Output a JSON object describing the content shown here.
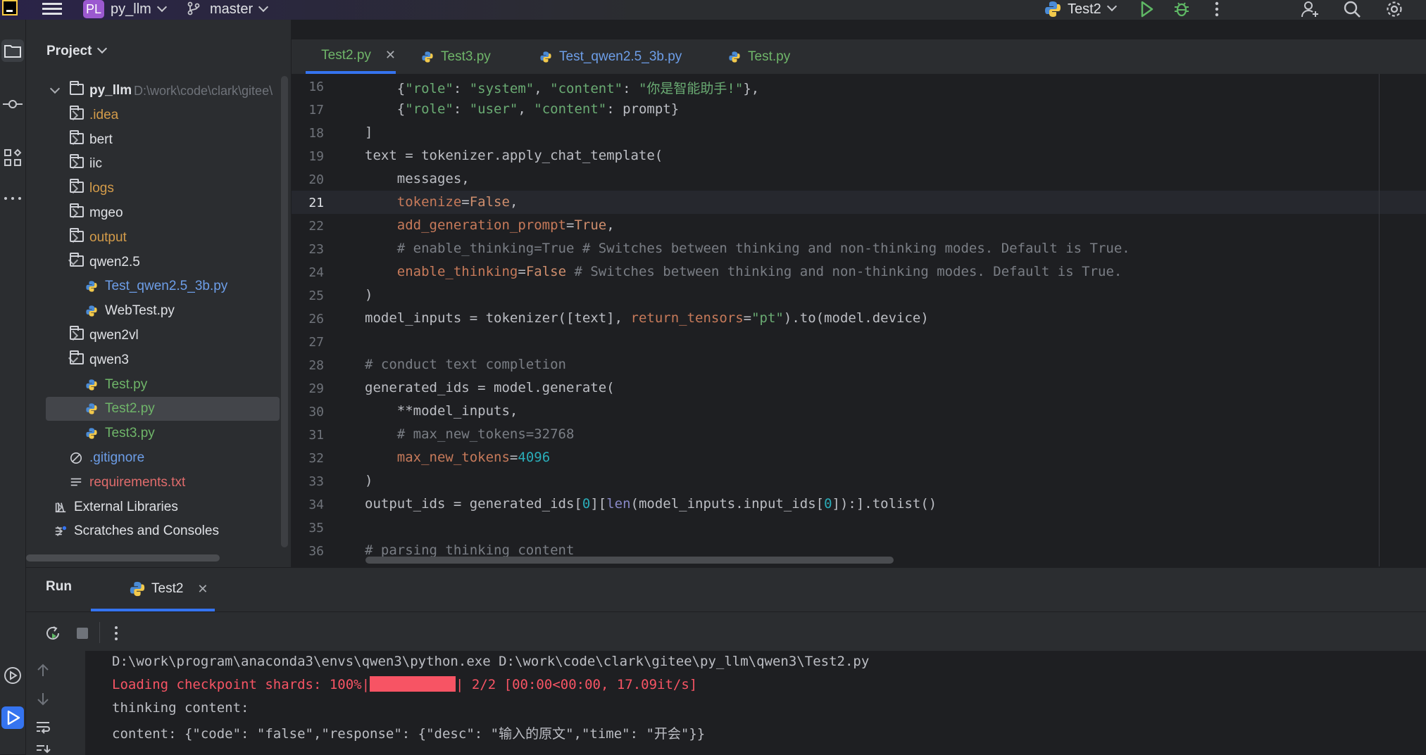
{
  "topbar": {
    "project_badge": "PL",
    "project_name": "py_llm",
    "branch": "master",
    "run_config": "Test2"
  },
  "project_panel": {
    "title": "Project",
    "root": {
      "name": "py_llm",
      "path": "D:\\work\\code\\clark\\gitee\\"
    },
    "items": [
      {
        "label": ".idea",
        "type": "folder",
        "color": "orange"
      },
      {
        "label": "bert",
        "type": "folder",
        "color": "default"
      },
      {
        "label": "iic",
        "type": "folder",
        "color": "default"
      },
      {
        "label": "logs",
        "type": "folder",
        "color": "orange"
      },
      {
        "label": "mgeo",
        "type": "folder",
        "color": "default"
      },
      {
        "label": "output",
        "type": "folder",
        "color": "orange"
      },
      {
        "label": "qwen2.5",
        "type": "folder",
        "color": "default"
      },
      {
        "label": "Test_qwen2.5_3b.py",
        "type": "py",
        "color": "blue"
      },
      {
        "label": "WebTest.py",
        "type": "py",
        "color": "default"
      },
      {
        "label": "qwen2vl",
        "type": "folder",
        "color": "default"
      },
      {
        "label": "qwen3",
        "type": "folder",
        "color": "default"
      },
      {
        "label": "Test.py",
        "type": "py",
        "color": "green"
      },
      {
        "label": "Test2.py",
        "type": "py",
        "color": "green"
      },
      {
        "label": "Test3.py",
        "type": "py",
        "color": "green"
      },
      {
        "label": ".gitignore",
        "type": "ignore",
        "color": "blue"
      },
      {
        "label": "requirements.txt",
        "type": "text",
        "color": "red"
      },
      {
        "label": "External Libraries",
        "type": "lib",
        "color": "default"
      },
      {
        "label": "Scratches and Consoles",
        "type": "scratch",
        "color": "default"
      }
    ]
  },
  "tabs": [
    {
      "label": "Test2.py",
      "color": "#6fb569"
    },
    {
      "label": "Test3.py",
      "color": "#6fb569"
    },
    {
      "label": "Test_qwen2.5_3b.py",
      "color": "#6d9ee8"
    },
    {
      "label": "Test.py",
      "color": "#6fb569"
    }
  ],
  "editor": {
    "line_numbers": [
      "16",
      "17",
      "18",
      "19",
      "20",
      "21",
      "22",
      "23",
      "24",
      "25",
      "26",
      "27",
      "28",
      "29",
      "30",
      "31",
      "32",
      "33",
      "34",
      "35",
      "36"
    ],
    "current_line": "21"
  },
  "run_panel": {
    "title": "Run",
    "tab": "Test2",
    "console": [
      "D:\\work\\program\\anaconda3\\envs\\qwen3\\python.exe D:\\work\\code\\clark\\gitee\\py_llm\\qwen3\\Test2.py",
      "Loading checkpoint shards: 100%|",
      "| 2/2 [00:00<00:00, 17.09it/s]",
      "thinking content:",
      "content: {\"code\": \"false\",\"response\": {\"desc\": \"输入的原文\",\"time\": \"开会\"}}"
    ]
  },
  "colors": {
    "accent": "#3574f0",
    "editor_bg": "#1e1f22",
    "panel_bg": "#2b2d30"
  }
}
